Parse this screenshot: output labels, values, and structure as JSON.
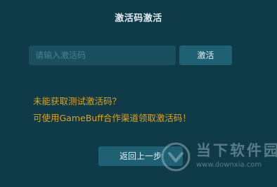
{
  "dialog": {
    "title": "激活码激活",
    "input_placeholder": "请输入激活码",
    "input_value": "",
    "activate_label": "激活",
    "hint_line1": "未能获取测试激活码？",
    "hint_line2": "可使用GameBuff合作渠道领取激活码！",
    "back_label": "返回上一步"
  },
  "watermark": {
    "site_name": "当下软件园",
    "site_url": "www.downxia.com",
    "logo_icon": "downxia-logo-icon"
  },
  "colors": {
    "background": "#0f3a48",
    "input_bg": "#194f5f",
    "button_bg": "#1e6172",
    "hint_text": "#e0a21a",
    "title_text": "#dfeaf0"
  }
}
